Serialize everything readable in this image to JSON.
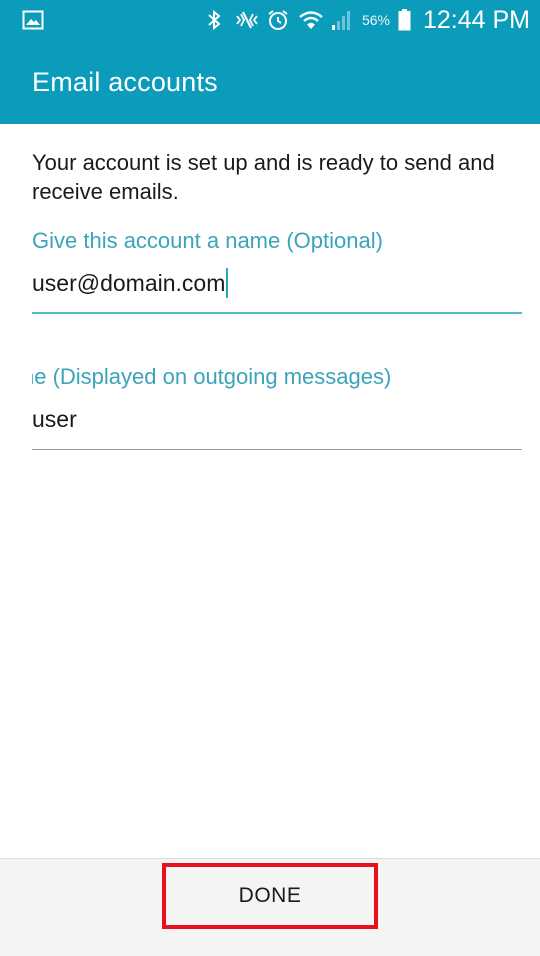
{
  "status_bar": {
    "battery_percent": "56%",
    "time": "12:44 PM",
    "icons": [
      "gallery-icon",
      "bluetooth-icon",
      "mute-icon",
      "alarm-icon",
      "wifi-icon",
      "signal-icon",
      "battery-icon"
    ]
  },
  "app_bar": {
    "title": "Email accounts"
  },
  "main": {
    "message": "Your account is set up and is ready to send and receive emails.",
    "account_name": {
      "label": "Give this account a name (Optional)",
      "value": "user@domain.com"
    },
    "display_name": {
      "label": "ne (Displayed on outgoing messages)",
      "value": "user"
    }
  },
  "footer": {
    "done_label": "DONE"
  },
  "colors": {
    "header": "#0a9cba",
    "label_accent": "#3ba4ba",
    "highlight_border": "#e8101a"
  }
}
